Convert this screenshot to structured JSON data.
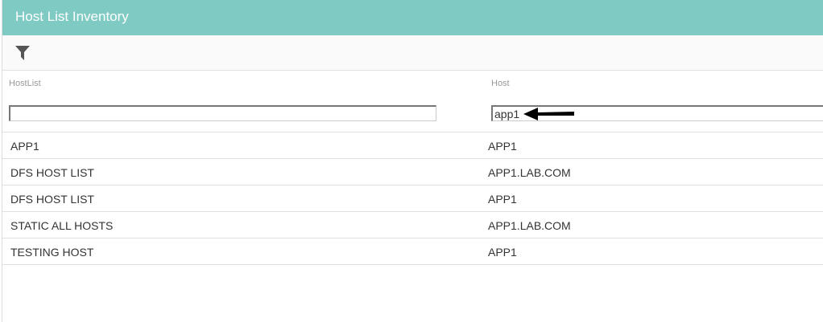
{
  "header": {
    "title": "Host List Inventory"
  },
  "toolbar": {
    "filter_icon": "filter-icon"
  },
  "columns": [
    {
      "label": "HostList",
      "filter": ""
    },
    {
      "label": "Host",
      "filter": "app1"
    }
  ],
  "rows": [
    {
      "hostlist": "APP1",
      "host": "APP1"
    },
    {
      "hostlist": "DFS HOST LIST",
      "host": "APP1.LAB.COM"
    },
    {
      "hostlist": "DFS HOST LIST",
      "host": "APP1"
    },
    {
      "hostlist": "STATIC ALL HOSTS",
      "host": "APP1.LAB.COM"
    },
    {
      "hostlist": "TESTING HOST",
      "host": "APP1"
    }
  ]
}
